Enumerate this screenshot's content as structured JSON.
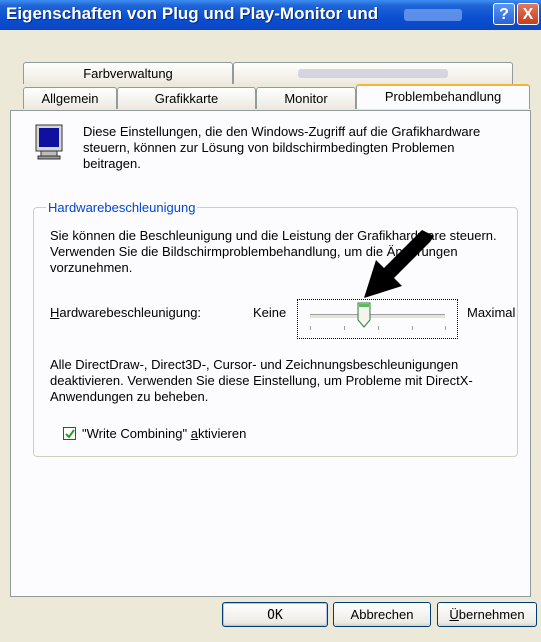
{
  "window": {
    "title": "Eigenschaften von Plug und Play-Monitor und",
    "help_label": "?",
    "close_label": "X"
  },
  "tabs": {
    "farbverwaltung": "Farbverwaltung",
    "allgemein": "Allgemein",
    "grafikkarte": "Grafikkarte",
    "monitor": "Monitor",
    "problembehandlung": "Problembehandlung"
  },
  "intro": {
    "text": "Diese Einstellungen, die den Windows-Zugriff auf die Grafikhardware steuern, können zur Lösung von bildschirmbedingten Problemen beitragen."
  },
  "hardware": {
    "group_title": "Hardwarebeschleunigung",
    "description": "Sie können die Beschleunigung und die Leistung der Grafikhardware steuern. Verwenden Sie die Bildschirmproblembehandlung, um die Änderungen vorzunehmen.",
    "slider_label_prefix": "H",
    "slider_label_rest": "ardwarebeschleunigung:",
    "min_label": "Keine",
    "max_label": "Maximal",
    "slider_level": 0.4,
    "note": "Alle DirectDraw-, Direct3D-, Cursor- und Zeichnungsbeschleunigungen deaktivieren. Verwenden Sie diese Einstellung, um Probleme mit DirectX-Anwendungen zu beheben.",
    "wc_label_a": "\"Write Combining\" ",
    "wc_label_u": "a",
    "wc_label_b": "ktivieren",
    "wc_checked": true
  },
  "buttons": {
    "ok": "OK",
    "cancel": "Abbrechen",
    "apply_u": "Ü",
    "apply_rest": "bernehmen"
  },
  "colors": {
    "titlebar": "#0a4fd0",
    "group_title": "#0046d5",
    "active_tab_accent": "#f6b33c"
  }
}
